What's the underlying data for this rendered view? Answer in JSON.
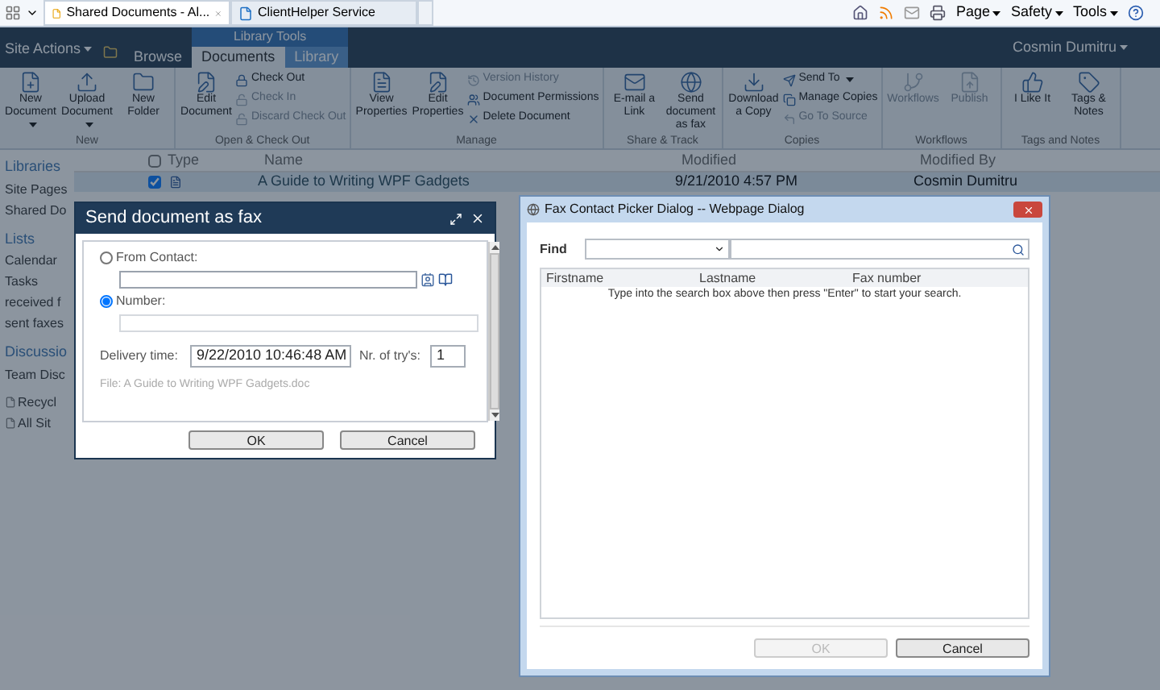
{
  "browser": {
    "tabs": [
      {
        "label": "Shared Documents - Al...",
        "selected": true
      },
      {
        "label": "ClientHelper Service",
        "selected": false
      }
    ],
    "tools": [
      "Page",
      "Safety",
      "Tools"
    ]
  },
  "top_bar": {
    "site_actions": "Site Actions",
    "context_label": "Library Tools",
    "tabs": [
      {
        "label": "Browse",
        "selected": false
      },
      {
        "label": "Documents",
        "selected": true
      },
      {
        "label": "Library",
        "selected": false
      }
    ],
    "user": "Cosmin Dumitru"
  },
  "ribbon": {
    "groups": [
      {
        "label": "New",
        "items": [
          {
            "label": "New Document",
            "kind": "large",
            "menu": true,
            "disabled": false
          },
          {
            "label": "Upload Document",
            "kind": "large",
            "menu": true,
            "disabled": false
          },
          {
            "label": "New Folder",
            "kind": "large",
            "menu": false,
            "disabled": false
          }
        ]
      },
      {
        "label": "Open & Check Out",
        "items": [
          {
            "label": "Edit Document",
            "kind": "large",
            "menu": false,
            "disabled": false
          },
          {
            "label": "Check Out",
            "kind": "small",
            "menu": false,
            "disabled": false
          },
          {
            "label": "Check In",
            "kind": "small",
            "menu": false,
            "disabled": true
          },
          {
            "label": "Discard Check Out",
            "kind": "small",
            "menu": false,
            "disabled": true
          }
        ]
      },
      {
        "label": "Manage",
        "items": [
          {
            "label": "View Properties",
            "kind": "large",
            "menu": false,
            "disabled": false
          },
          {
            "label": "Edit Properties",
            "kind": "large",
            "menu": false,
            "disabled": false
          },
          {
            "label": "Version History",
            "kind": "small",
            "menu": false,
            "disabled": true
          },
          {
            "label": "Document Permissions",
            "kind": "small",
            "menu": false,
            "disabled": false
          },
          {
            "label": "Delete Document",
            "kind": "small",
            "menu": false,
            "disabled": false
          }
        ]
      },
      {
        "label": "Share & Track",
        "items": [
          {
            "label": "E-mail a Link",
            "kind": "large",
            "menu": false,
            "disabled": false
          },
          {
            "label": "Send document as fax",
            "kind": "large",
            "menu": false,
            "disabled": false
          }
        ]
      },
      {
        "label": "Copies",
        "items": [
          {
            "label": "Download a Copy",
            "kind": "large",
            "menu": false,
            "disabled": false
          },
          {
            "label": "Send To",
            "kind": "small",
            "menu": true,
            "disabled": false
          },
          {
            "label": "Manage Copies",
            "kind": "small",
            "menu": false,
            "disabled": false
          },
          {
            "label": "Go To Source",
            "kind": "small",
            "menu": false,
            "disabled": true
          }
        ]
      },
      {
        "label": "Workflows",
        "items": [
          {
            "label": "Workflows",
            "kind": "large",
            "menu": false,
            "disabled": true
          },
          {
            "label": "Publish",
            "kind": "large",
            "menu": false,
            "disabled": true
          }
        ]
      },
      {
        "label": "Tags and Notes",
        "items": [
          {
            "label": "I Like It",
            "kind": "large",
            "menu": false,
            "disabled": false
          },
          {
            "label": "Tags & Notes",
            "kind": "large",
            "menu": false,
            "disabled": false
          }
        ]
      }
    ]
  },
  "nav": {
    "sections": [
      {
        "heading": "Libraries",
        "items": [
          "Site Pages",
          "Shared Do"
        ]
      },
      {
        "heading": "Lists",
        "items": [
          "Calendar",
          "Tasks",
          "received f",
          "sent faxes"
        ]
      },
      {
        "heading": "Discussio",
        "items": [
          "Team Disc"
        ]
      }
    ],
    "footer": [
      "Recycl",
      "All Sit"
    ]
  },
  "list": {
    "columns": [
      "Type",
      "Name",
      "Modified",
      "Modified By"
    ],
    "all_checked": false,
    "rows": [
      {
        "checked": true,
        "name": "A Guide to Writing WPF Gadgets",
        "modified": "9/21/2010 4:57 PM",
        "modified_by": "Cosmin Dumitru"
      }
    ]
  },
  "fax_dialog": {
    "title": "Send document as fax",
    "options": [
      {
        "label": "From Contact:",
        "selected": false,
        "kind": "contact"
      },
      {
        "label": "Number:",
        "selected": true,
        "kind": "number"
      }
    ],
    "delivery_label": "Delivery time:",
    "delivery_value": "9/22/2010 10:46:48 AM",
    "tries_label": "Nr. of try's:",
    "tries_value": "1",
    "file_note": "File: A Guide to Writing WPF Gadgets.doc",
    "buttons": [
      {
        "label": "OK",
        "disabled": false
      },
      {
        "label": "Cancel",
        "disabled": false
      }
    ]
  },
  "picker": {
    "title": "Fax Contact Picker Dialog -- Webpage Dialog",
    "find_label": "Find",
    "columns": [
      "Firstname",
      "Lastname",
      "Fax number"
    ],
    "message": "Type into the search box above then press \"Enter\" to start your search.",
    "buttons": [
      {
        "label": "OK",
        "disabled": true
      },
      {
        "label": "Cancel",
        "disabled": false
      }
    ]
  }
}
